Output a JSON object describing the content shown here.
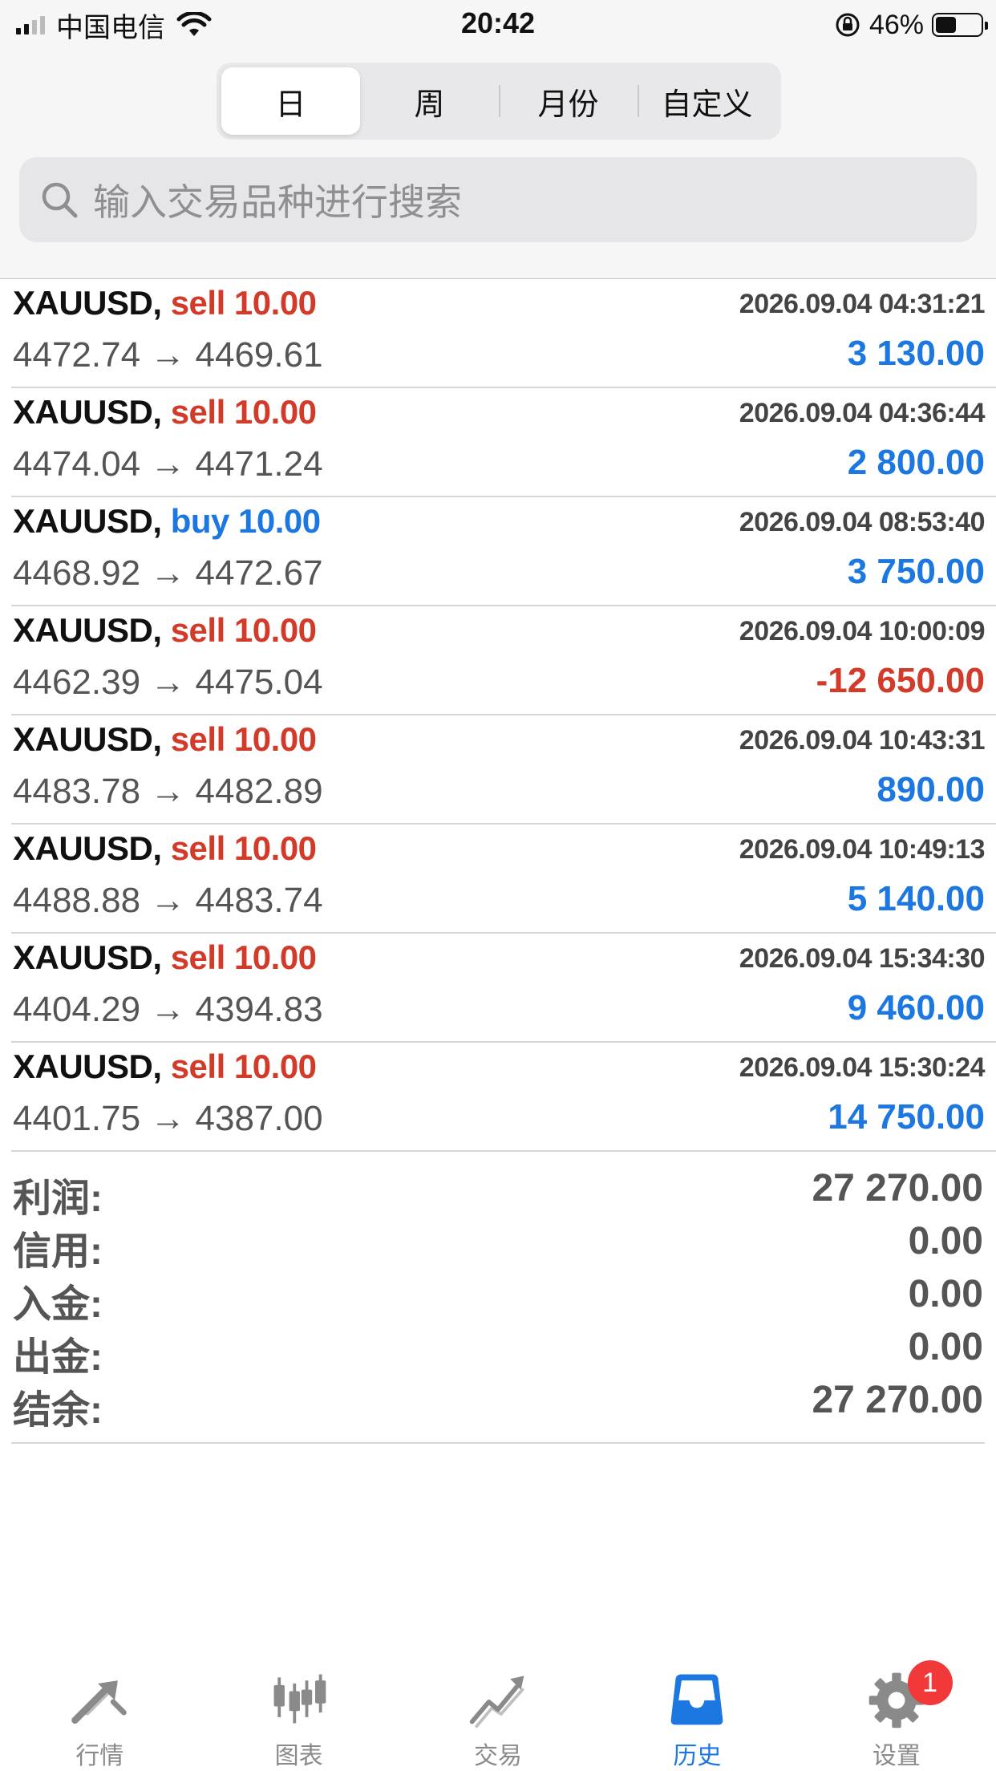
{
  "status_bar": {
    "carrier": "中国电信",
    "time": "20:42",
    "battery_percent": "46%",
    "battery_level": 0.46
  },
  "period_tabs": [
    {
      "label": "日",
      "active": true
    },
    {
      "label": "周",
      "active": false
    },
    {
      "label": "月份",
      "active": false
    },
    {
      "label": "自定义",
      "active": false
    }
  ],
  "search": {
    "placeholder": "输入交易品种进行搜索"
  },
  "deals": [
    {
      "symbol": "XAUUSD,",
      "side": "sell 10.00",
      "side_type": "sell",
      "time": "2026.09.04 04:31:21",
      "prices": "4472.74 → 4469.61",
      "profit": "3 130.00",
      "profit_sign": "pos"
    },
    {
      "symbol": "XAUUSD,",
      "side": "sell 10.00",
      "side_type": "sell",
      "time": "2026.09.04 04:36:44",
      "prices": "4474.04 → 4471.24",
      "profit": "2 800.00",
      "profit_sign": "pos"
    },
    {
      "symbol": "XAUUSD,",
      "side": "buy 10.00",
      "side_type": "buy",
      "time": "2026.09.04 08:53:40",
      "prices": "4468.92 → 4472.67",
      "profit": "3 750.00",
      "profit_sign": "pos"
    },
    {
      "symbol": "XAUUSD,",
      "side": "sell 10.00",
      "side_type": "sell",
      "time": "2026.09.04 10:00:09",
      "prices": "4462.39 → 4475.04",
      "profit": "-12 650.00",
      "profit_sign": "neg"
    },
    {
      "symbol": "XAUUSD,",
      "side": "sell 10.00",
      "side_type": "sell",
      "time": "2026.09.04 10:43:31",
      "prices": "4483.78 → 4482.89",
      "profit": "890.00",
      "profit_sign": "pos"
    },
    {
      "symbol": "XAUUSD,",
      "side": "sell 10.00",
      "side_type": "sell",
      "time": "2026.09.04 10:49:13",
      "prices": "4488.88 → 4483.74",
      "profit": "5 140.00",
      "profit_sign": "pos"
    },
    {
      "symbol": "XAUUSD,",
      "side": "sell 10.00",
      "side_type": "sell",
      "time": "2026.09.04 15:34:30",
      "prices": "4404.29 → 4394.83",
      "profit": "9 460.00",
      "profit_sign": "pos"
    },
    {
      "symbol": "XAUUSD,",
      "side": "sell 10.00",
      "side_type": "sell",
      "time": "2026.09.04 15:30:24",
      "prices": "4401.75 → 4387.00",
      "profit": "14 750.00",
      "profit_sign": "pos"
    }
  ],
  "summary": [
    {
      "label": "利润:",
      "value": "27 270.00"
    },
    {
      "label": "信用:",
      "value": "0.00"
    },
    {
      "label": "入金:",
      "value": "0.00"
    },
    {
      "label": "出金:",
      "value": "0.00"
    },
    {
      "label": "结余:",
      "value": "27 270.00"
    }
  ],
  "tabbar": [
    {
      "label": "行情",
      "icon": "quotes-arrows-icon",
      "active": false
    },
    {
      "label": "图表",
      "icon": "chart-candles-icon",
      "active": false
    },
    {
      "label": "交易",
      "icon": "trade-trend-icon",
      "active": false
    },
    {
      "label": "历史",
      "icon": "history-inbox-icon",
      "active": true
    },
    {
      "label": "设置",
      "icon": "settings-gear-icon",
      "active": false,
      "badge": "1"
    }
  ],
  "colors": {
    "sell": "#d23a2a",
    "buy": "#1c77e0",
    "profit_positive": "#1c77e0",
    "profit_negative": "#d23a2a",
    "tab_active": "#1c77e0",
    "tab_inactive": "#8a8a8a",
    "badge": "#f2393a"
  }
}
